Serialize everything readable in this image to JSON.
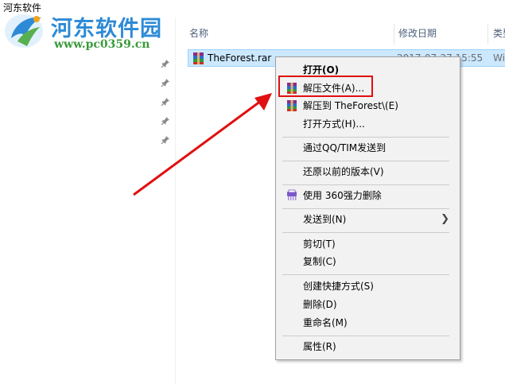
{
  "window": {
    "title": "河东软件"
  },
  "watermark": {
    "name": "河东软件园",
    "url": "www.pc0359.cn"
  },
  "columns": {
    "name": "名称",
    "date": "修改日期",
    "type": "类型"
  },
  "file": {
    "name": "TheForest.rar",
    "date": "2017-07-27 15:55",
    "type": "Wi"
  },
  "context_menu": {
    "open": "打开(O)",
    "extract_files": "解压文件(A)...",
    "extract_to": "解压到 TheForest\\(E)",
    "open_with": "打开方式(H)...",
    "send_qq": "通过QQ/TIM发送到",
    "restore": "还原以前的版本(V)",
    "delete_360": "使用 360强力删除",
    "send_to": "发送到(N)",
    "cut": "剪切(T)",
    "copy": "复制(C)",
    "create_shortcut": "创建快捷方式(S)",
    "delete": "删除(D)",
    "rename": "重命名(M)",
    "properties": "属性(R)"
  },
  "colors": {
    "highlight": "#e01010",
    "arrow": "#e01010",
    "selection": "#cce8ff",
    "watermark_blue": "#2d8ad6",
    "watermark_green": "#3b9a3b"
  }
}
